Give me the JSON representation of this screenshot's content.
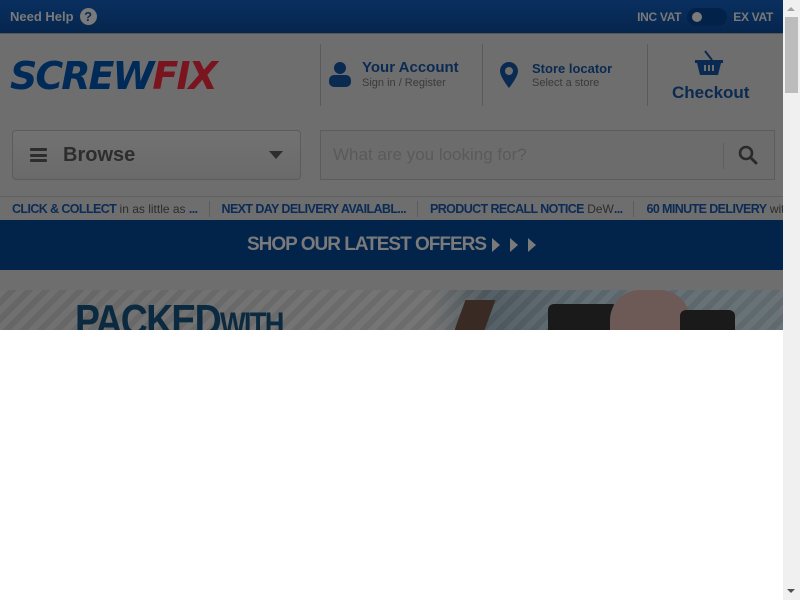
{
  "topbar": {
    "need_help": "Need Help",
    "help_icon": "?",
    "vat_inc": "INC VAT",
    "vat_ex": "EX VAT"
  },
  "logo": {
    "part1": "SCREW",
    "part2": "FIX"
  },
  "account": {
    "title": "Your Account",
    "subtitle": "Sign in / Register",
    "icon": "user-icon"
  },
  "store": {
    "title": "Store locator",
    "subtitle": "Select a store",
    "icon": "location-pin-icon"
  },
  "checkout": {
    "label": "Checkout",
    "icon": "basket-icon"
  },
  "browse": {
    "label": "Browse"
  },
  "search": {
    "placeholder": "What are you looking for?",
    "value": ""
  },
  "usp": [
    {
      "bold": "CLICK & COLLECT",
      "text": " in as little as ",
      "tail": "..."
    },
    {
      "bold": "NEXT DAY DELIVERY AVAILABL...",
      "text": "",
      "tail": ""
    },
    {
      "bold": "PRODUCT RECALL NOTICE",
      "text": " DeW",
      "tail": "..."
    },
    {
      "bold": "60 MINUTE DELIVERY",
      "text": " with Sprint",
      "tail": ""
    }
  ],
  "offers": {
    "label": "SHOP OUR LATEST OFFERS"
  },
  "hero": {
    "headline": "PACKED",
    "headline_small": "WITH"
  },
  "colors": {
    "brand_blue": "#003D7A",
    "brand_red": "#C8102E",
    "overlay": "#6e6e6e"
  }
}
